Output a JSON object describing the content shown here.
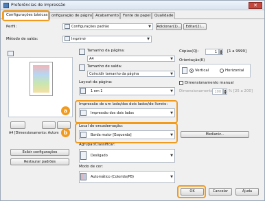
{
  "window": {
    "title": "Preferências de Impressão",
    "close": "✕"
  },
  "tabs": [
    {
      "label": "Configurações básicas"
    },
    {
      "label": "onfiguração de página"
    },
    {
      "label": "Acabamento"
    },
    {
      "label": "Fonte de papel"
    },
    {
      "label": "Qualidade"
    }
  ],
  "profile": {
    "label": "Perfil:",
    "value": "Configurações padrão",
    "add": "Adicionar(1)...",
    "edit": "Editar(2)..."
  },
  "output": {
    "label": "Método de saída:",
    "value": "Imprimir"
  },
  "preview": {
    "caption": "A4 [Dimensionamento: Autom"
  },
  "left_buttons": {
    "show_settings": "Exibir configurações",
    "restore": "Restaurar padrões"
  },
  "page": {
    "size_label": "Tamanho da página:",
    "size_value": "A4",
    "output_size_label": "Tamanho de saída:",
    "output_size_value": "Coincidir tamanho da página",
    "layout_label": "Layout da página:",
    "layout_value": "1 em 1",
    "copies_label": "Cópias(Q):",
    "copies_value": "1",
    "copies_range": "[1 a 9999]",
    "orientation_label": "Orientação(K)",
    "portrait": "Vertical",
    "landscape": "Horizontal",
    "manual_scaling": "Dimensionamento manual",
    "scaling_label": "Dimensionamento:",
    "scaling_value": "100",
    "scaling_range": "% [25 a 200]"
  },
  "duplex": {
    "label": "Impressão de um lado/dos dois lados/de livreto:",
    "value": "Impressão dos dois lados"
  },
  "binding": {
    "label": "Local de encadernação:",
    "value": "Borda maior [Esquerda]",
    "margin_button": "Medianiz..."
  },
  "grouping": {
    "label": "Agrupar/Classificar:",
    "value": "Desligado"
  },
  "color": {
    "label": "Modo de cor:",
    "value": "Automático (Colorido/PB)"
  },
  "footer": {
    "ok": "OK",
    "cancel": "Cancelar",
    "help": "Ajuda"
  },
  "badges": {
    "a": "a",
    "b": "b"
  },
  "colors": {
    "highlight": "#f29a1b",
    "titlebar": "#d9e3ef"
  }
}
